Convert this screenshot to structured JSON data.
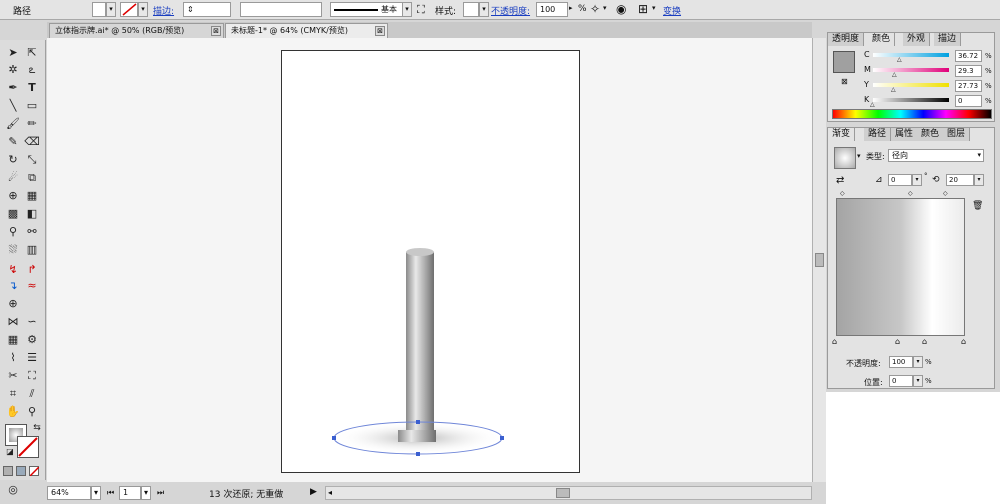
{
  "control_bar": {
    "object_type": "路径",
    "stroke_label": "描边:",
    "stroke_style": "基本",
    "style_label": "样式:",
    "opacity_label": "不透明度:",
    "opacity_value": "100",
    "opacity_unit": "%",
    "transform_label": "变换"
  },
  "tabs": [
    {
      "label": "立体指示牌.ai* @ 50% (RGB/预览)",
      "close": "⊠"
    },
    {
      "label": "未标题-1* @ 64% (CMYK/预览)",
      "close": "⊠"
    }
  ],
  "status": {
    "zoom": "64%",
    "page": "1",
    "history": "13 次还原; 无重做"
  },
  "color_panel": {
    "tabs": [
      "透明度",
      "颜色",
      "外观",
      "描边"
    ],
    "active_tab": "颜色",
    "channels": [
      {
        "name": "C",
        "value": "36.72",
        "unit": "%",
        "position": 0.3672
      },
      {
        "name": "M",
        "value": "29.3",
        "unit": "%",
        "position": 0.293
      },
      {
        "name": "Y",
        "value": "27.73",
        "unit": "%",
        "position": 0.2773
      },
      {
        "name": "K",
        "value": "0",
        "unit": "%",
        "position": 0.0
      }
    ]
  },
  "gradient_panel": {
    "tabs": [
      "渐变",
      "路径",
      "属性",
      "颜色",
      "图层"
    ],
    "active_tab": "渐变",
    "type_label": "类型:",
    "type_value": "径向",
    "angle_value": "0",
    "angle_unit": "°",
    "aspect_value": "20",
    "opacity_label": "不透明度:",
    "opacity_value": "100",
    "opacity_unit": "%",
    "location_label": "位置:",
    "location_value": "0",
    "location_unit": "%"
  },
  "colors": {
    "cyan": "#00a0e0",
    "magenta": "#e0007a",
    "yellow": "#f0e000",
    "selection": "#3b5fd0"
  }
}
